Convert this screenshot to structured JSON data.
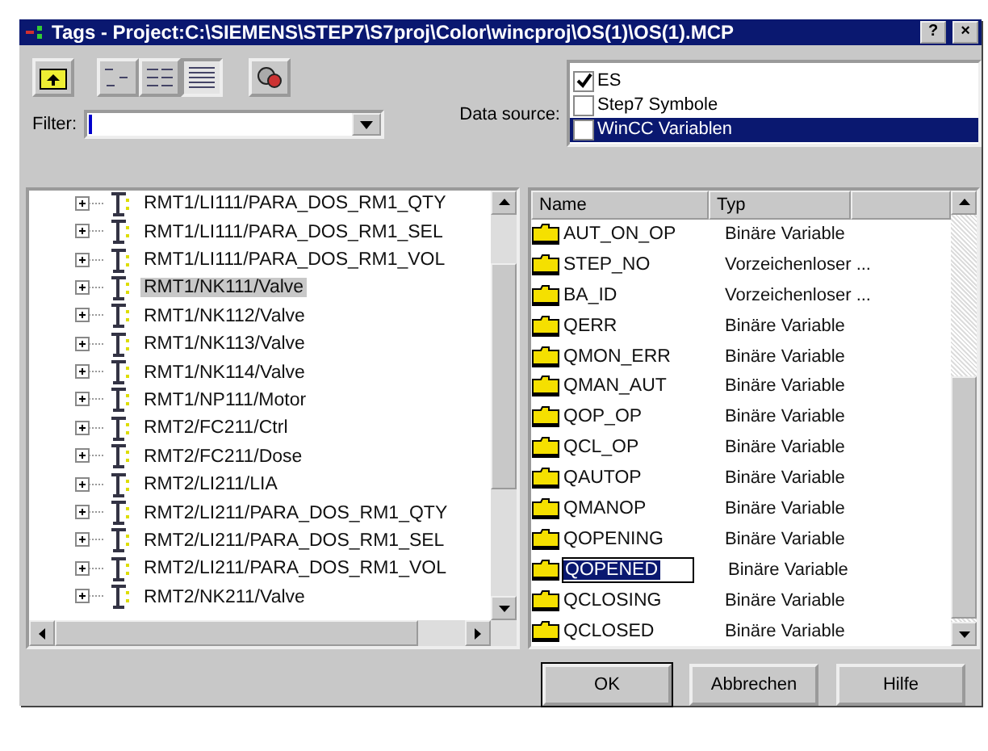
{
  "window": {
    "title": "Tags - Project:C:\\SIEMENS\\STEP7\\S7proj\\Color\\wincproj\\OS(1)\\OS(1).MCP",
    "controls": [
      "?",
      "×"
    ]
  },
  "toolbar": [
    {
      "kind": "up",
      "selected": false
    },
    {
      "kind": "small-icons",
      "selected": false
    },
    {
      "kind": "list",
      "selected": false
    },
    {
      "kind": "details",
      "selected": true
    },
    {
      "kind": "filter",
      "selected": false
    }
  ],
  "filter": {
    "label": "Filter:"
  },
  "data_source": {
    "label": "Data source:",
    "items": [
      {
        "label": "ES",
        "checked": true,
        "selected": false
      },
      {
        "label": "Step7 Symbole",
        "checked": false,
        "selected": false
      },
      {
        "label": "WinCC Variablen",
        "checked": false,
        "selected": true
      }
    ]
  },
  "tree": {
    "items": [
      {
        "label": "RMT1/LI111/PARA_DOS_RM1_QTY",
        "selected": false
      },
      {
        "label": "RMT1/LI111/PARA_DOS_RM1_SEL",
        "selected": false
      },
      {
        "label": "RMT1/LI111/PARA_DOS_RM1_VOL",
        "selected": false
      },
      {
        "label": "RMT1/NK111/Valve",
        "selected": true
      },
      {
        "label": "RMT1/NK112/Valve",
        "selected": false
      },
      {
        "label": "RMT1/NK113/Valve",
        "selected": false
      },
      {
        "label": "RMT1/NK114/Valve",
        "selected": false
      },
      {
        "label": "RMT1/NP111/Motor",
        "selected": false
      },
      {
        "label": "RMT2/FC211/Ctrl",
        "selected": false
      },
      {
        "label": "RMT2/FC211/Dose",
        "selected": false
      },
      {
        "label": "RMT2/LI211/LIA",
        "selected": false
      },
      {
        "label": "RMT2/LI211/PARA_DOS_RM1_QTY",
        "selected": false
      },
      {
        "label": "RMT2/LI211/PARA_DOS_RM1_SEL",
        "selected": false
      },
      {
        "label": "RMT2/LI211/PARA_DOS_RM1_VOL",
        "selected": false
      },
      {
        "label": "RMT2/NK211/Valve",
        "selected": false
      }
    ]
  },
  "table": {
    "columns": [
      "Name",
      "Typ"
    ],
    "rows": [
      {
        "name": "AUT_ON_OP",
        "type": "Binäre Variable",
        "editing": false
      },
      {
        "name": "STEP_NO",
        "type": "Vorzeichenloser ...",
        "editing": false
      },
      {
        "name": "BA_ID",
        "type": "Vorzeichenloser ...",
        "editing": false
      },
      {
        "name": "QERR",
        "type": "Binäre Variable",
        "editing": false
      },
      {
        "name": "QMON_ERR",
        "type": "Binäre Variable",
        "editing": false
      },
      {
        "name": "QMAN_AUT",
        "type": "Binäre Variable",
        "editing": false
      },
      {
        "name": "QOP_OP",
        "type": "Binäre Variable",
        "editing": false
      },
      {
        "name": "QCL_OP",
        "type": "Binäre Variable",
        "editing": false
      },
      {
        "name": "QAUTOP",
        "type": "Binäre Variable",
        "editing": false
      },
      {
        "name": "QMANOP",
        "type": "Binäre Variable",
        "editing": false
      },
      {
        "name": "QOPENING",
        "type": "Binäre Variable",
        "editing": false
      },
      {
        "name": "QOPENED",
        "type": "Binäre Variable",
        "editing": true
      },
      {
        "name": "QCLOSING",
        "type": "Binäre Variable",
        "editing": false
      },
      {
        "name": "QCLOSED",
        "type": "Binäre Variable",
        "editing": false
      }
    ]
  },
  "buttons": [
    "OK",
    "Abbrechen",
    "Hilfe"
  ]
}
